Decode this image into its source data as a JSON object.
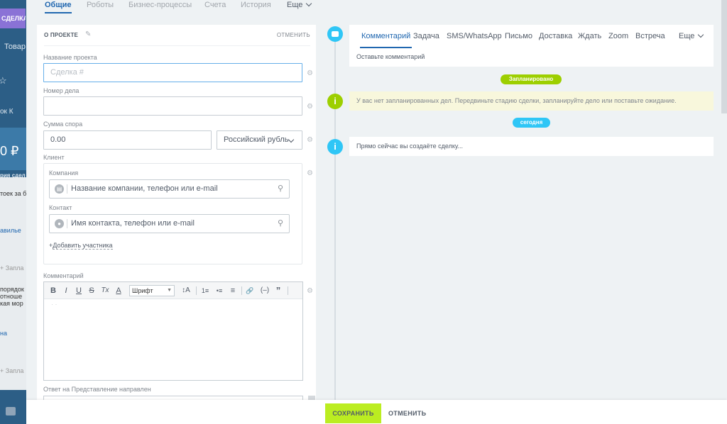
{
  "background": {
    "button": "СДЕЛКА",
    "texts": [
      "Товар",
      "☆",
      "ок  К",
      "0 ₽",
      "рия сдел",
      "тоек за б",
      "авилье",
      "+ Запла",
      "порядок",
      "отноше",
      "кая мор",
      "на",
      "+ Запла"
    ]
  },
  "top_tabs": [
    {
      "label": "Общие",
      "active": true
    },
    {
      "label": "Роботы"
    },
    {
      "label": "Бизнес-процессы"
    },
    {
      "label": "Счета"
    },
    {
      "label": "История"
    },
    {
      "label": "Еще"
    }
  ],
  "form": {
    "title": "О ПРОЕКТЕ",
    "cancel_label": "ОТМЕНИТЬ",
    "project_name_label": "Название проекта",
    "project_name_placeholder": "Сделка #",
    "case_number_label": "Номер дела",
    "case_number_value": "",
    "dispute_sum_label": "Сумма спора",
    "dispute_sum_value": "0.00",
    "currency": "Российский рубль",
    "client_label": "Клиент",
    "company_label": "Компания",
    "company_placeholder": "Название компании, телефон или e-mail",
    "contact_label": "Контакт",
    "contact_placeholder": "Имя контакта, телефон или e-mail",
    "add_participant": "Добавить участника",
    "comment_label": "Комментарий",
    "font_select": "Шрифт",
    "reply_label": "Ответ на Представление направлен"
  },
  "editor_toolbar": [
    "B",
    "I",
    "U",
    "S",
    "Tx",
    "A",
    "↕A",
    "1≡",
    "•≡",
    "≡",
    "🔗",
    "(–)",
    "”"
  ],
  "activity": {
    "tabs": [
      {
        "label": "Комментарий",
        "active": true
      },
      {
        "label": "Задача"
      },
      {
        "label": "SMS/WhatsApp"
      },
      {
        "label": "Письмо"
      },
      {
        "label": "Доставка"
      },
      {
        "label": "Ждать"
      },
      {
        "label": "Zoom"
      },
      {
        "label": "Встреча"
      }
    ],
    "more": "Еще",
    "hint": "Оставьте комментарий"
  },
  "timeline": {
    "planned_badge": "Запланировано",
    "planned_notice": "У вас нет запланированных дел. Передвиньте стадию сделки, запланируйте дело или поставьте ожидание.",
    "today_badge": "сегодня",
    "creating_text": "Прямо сейчас вы создаёте сделку..."
  },
  "footer": {
    "save": "СОХРАНИТЬ",
    "cancel": "ОТМЕНИТЬ"
  },
  "colors": {
    "accent_blue": "#2067b0",
    "save_green": "#bbed21",
    "badge_green": "#9dcf00",
    "badge_blue": "#2fc6f6"
  }
}
